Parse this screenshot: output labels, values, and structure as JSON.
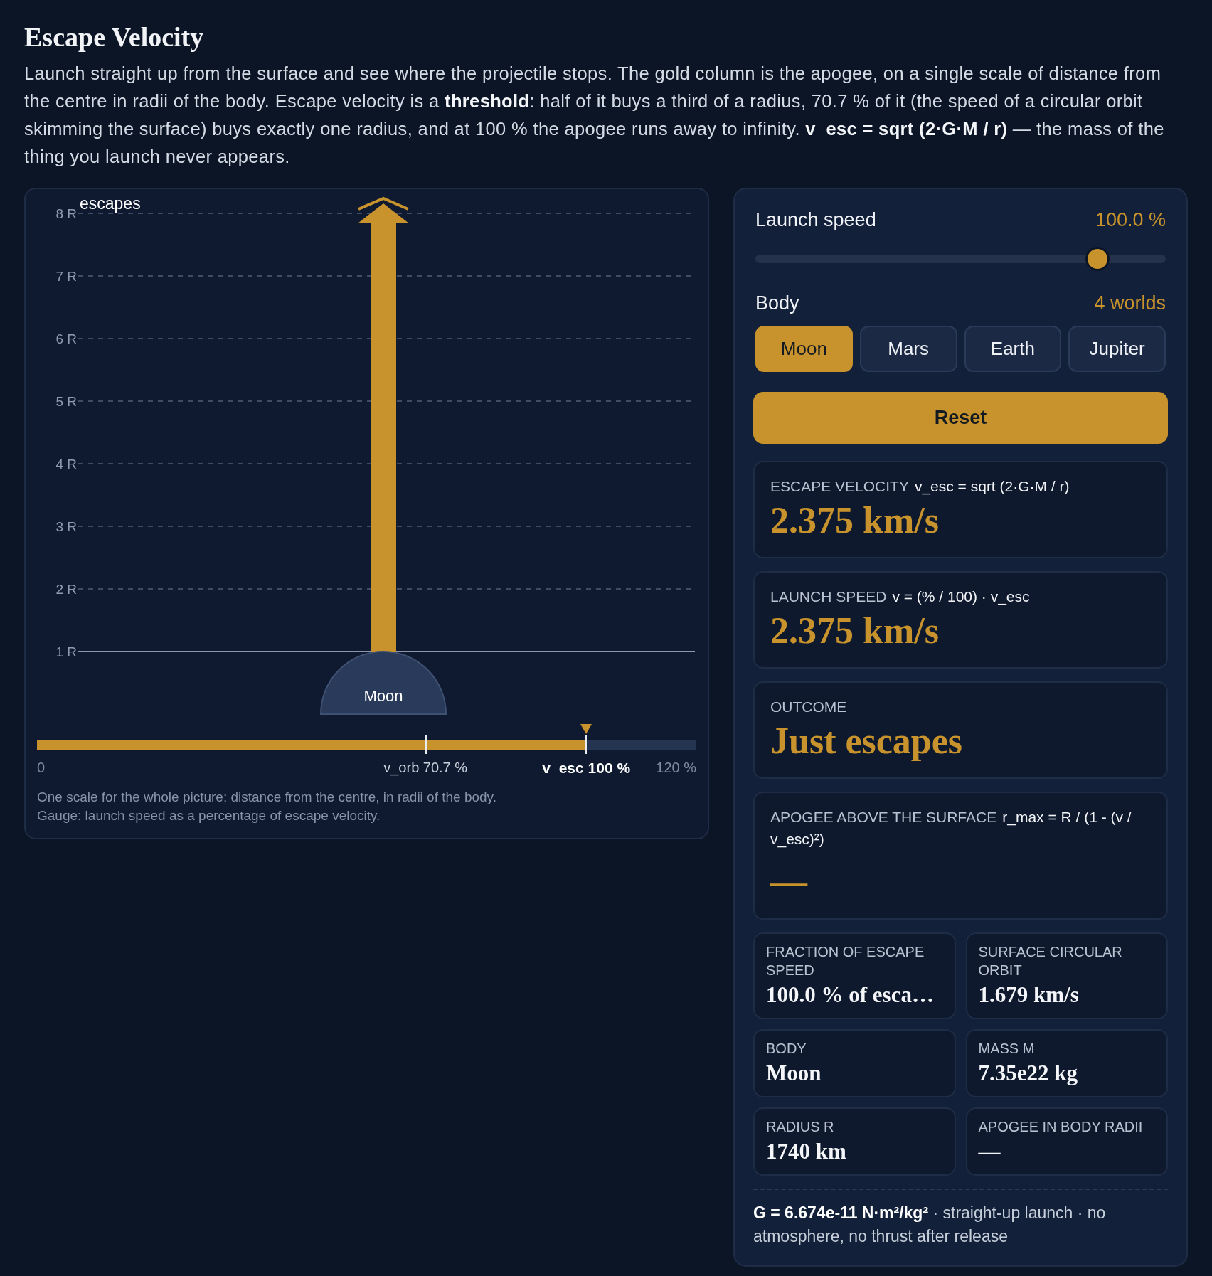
{
  "title": "Escape Velocity",
  "intro": "Launch straight up from the surface and see where the projectile stops. The gold column is the apogee, on a single scale of distance from the centre in radii of the body. Escape velocity is a **threshold**: half of it buys a third of a radius, 70.7 % of it (the speed of a circular orbit skimming the surface) buys exactly one radius, and at 100 % the apogee runs away to infinity. **v_esc = sqrt (2·G·M / r)** — the mass of the thing you launch never appears.",
  "chart": {
    "apogee_label": "escapes",
    "y_ticks": [
      "8 R",
      "7 R",
      "6 R",
      "5 R",
      "4 R",
      "3 R",
      "2 R",
      "1 R"
    ],
    "body_label": "Moon",
    "gauge": {
      "level": 0.833,
      "marks": [
        {
          "kind": "start",
          "label": "0"
        },
        {
          "kind": "orbit",
          "label": "v_orb 70.7 %"
        },
        {
          "kind": "escape",
          "label": "v_esc 100 %"
        },
        {
          "kind": "end",
          "label": "120 %"
        }
      ]
    },
    "caption": [
      "One scale for the whole picture: distance from the centre, in radii of the body.",
      "Gauge: launch speed as a percentage of escape velocity."
    ]
  },
  "controls": {
    "speed_label": "Launch speed",
    "speed_reading": "100.0 %",
    "slider": {
      "level": 0.833
    },
    "body_label": "Body",
    "body_count": "4 worlds",
    "bodies": [
      {
        "label": "Moon",
        "selected": true
      },
      {
        "label": "Mars",
        "selected": false
      },
      {
        "label": "Earth",
        "selected": false
      },
      {
        "label": "Jupiter",
        "selected": false
      }
    ],
    "reset": "Reset"
  },
  "cards": [
    {
      "label": "ESCAPE VELOCITY",
      "formula": "v_esc = sqrt (2·G·M / r)",
      "value": "2.375 km/s"
    },
    {
      "label": "LAUNCH SPEED",
      "formula": "v = (% / 100) · v_esc",
      "value": "2.375 km/s"
    },
    {
      "label": "OUTCOME",
      "value": "Just escapes"
    },
    {
      "label": "APOGEE ABOVE THE SURFACE",
      "formula": "r_max = R / (1 - (v / v_esc)²)",
      "value": "—"
    }
  ],
  "stats": [
    {
      "label": "FRACTION OF ESCAPE SPEED",
      "value": "100.0 % of esca…"
    },
    {
      "label": "SURFACE CIRCULAR ORBIT",
      "value": "1.679 km/s"
    },
    {
      "label": "BODY",
      "value": "Moon"
    },
    {
      "label": "MASS M",
      "value": "7.35e22 kg"
    },
    {
      "label": "RADIUS R",
      "value": "1740 km"
    },
    {
      "label": "APOGEE IN BODY RADII",
      "value": "—"
    }
  ],
  "footnote": "**G = 6.674e-11 N·m²/kg²** · straight-up launch · no atmosphere, no thrust after release"
}
